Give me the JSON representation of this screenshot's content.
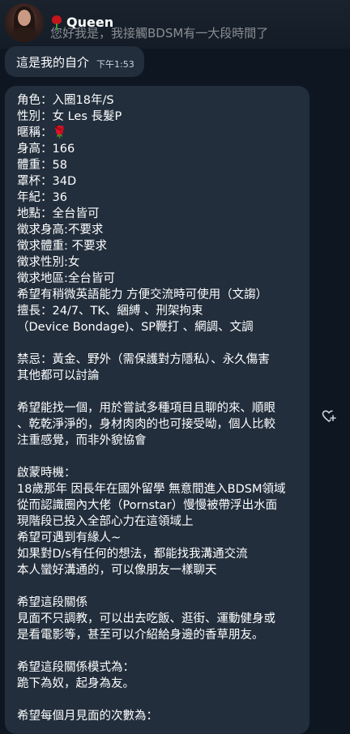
{
  "header": {
    "sender_name": "Queen",
    "reply_preview": "您好我是，我接觸BDSM有一大段時間了"
  },
  "intro_message": {
    "text": "這是我的自介",
    "time": "下午1:53"
  },
  "profile_message": {
    "lines": [
      "角色：入圈18年/S",
      "性別：女 Les 長髮P",
      "暱稱：🌹",
      "身高：166",
      "體重：58",
      "罩杯：34D",
      "年紀：36",
      "地點：全台皆可",
      "徵求身高:不要求",
      "徵求體重: 不要求",
      "徵求性別:女",
      "徵求地區:全台皆可",
      "希望有稍微英語能力 方便交流時可使用（文謅）",
      "擅長：24/7、TK、綑縛 、刑架拘束",
      "（Device Bondage)、SP鞭打 、網調、文調",
      "",
      "禁忌：黃金、野外（需保護對方隱私）、永久傷害",
      "其他都可以討論",
      "",
      "希望能找一個，用於嘗試多種項目且聊的來、順眼",
      "、乾乾淨淨的，身材肉肉的也可接受呦，個人比較",
      "注重感覺，而非外貌協會",
      "",
      "啟蒙時機：",
      "18歲那年 因長年在國外留學 無意間進入BDSM領域",
      "從而認識圈內大佬（Pornstar）慢慢被帶浮出水面",
      "現階段已投入全部心力在這領域上",
      "希望可遇到有緣人~",
      "如果對D/s有任何的想法，都能找我溝通交流",
      "本人蠻好溝通的，可以像朋友一樣聊天",
      "",
      "希望這段關係",
      "見面不只調教，可以出去吃飯、逛街、運動健身或",
      "是看電影等，甚至可以介紹給身邊的香草朋友。",
      "",
      "希望這段關係模式為：",
      "跪下為奴，起身為友。",
      "",
      "希望每個月見面的次數為："
    ]
  },
  "icons": {
    "avatar": "avatar-photo",
    "rose": "rose-icon",
    "react": "heart-plus-icon"
  }
}
